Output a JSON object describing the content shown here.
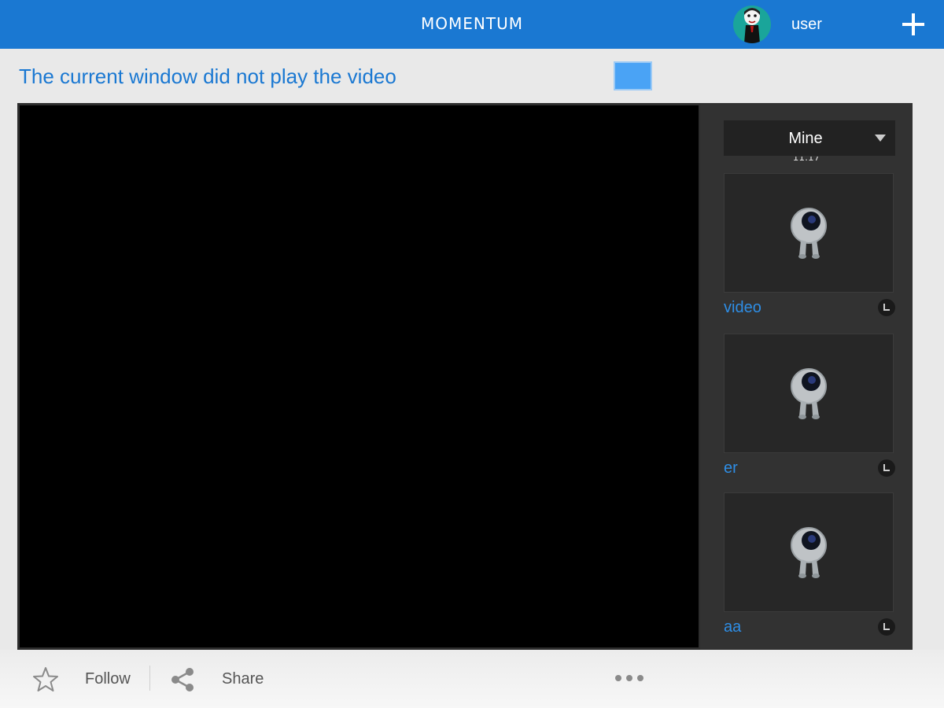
{
  "header": {
    "logo": "MOMENTUM",
    "username": "user",
    "add_icon": "plus-icon",
    "avatar_icon": "avatar"
  },
  "page": {
    "title": "The current window did not play the video"
  },
  "sidebar": {
    "dropdown_value": "Mine",
    "clipped_text": "11:17",
    "items": [
      {
        "label": "video",
        "icon": "clock-icon"
      },
      {
        "label": "er",
        "icon": "clock-icon"
      },
      {
        "label": "aa",
        "icon": "clock-icon"
      }
    ]
  },
  "footer": {
    "follow_label": "Follow",
    "share_label": "Share",
    "star_icon": "star-icon",
    "share_icon": "share-icon",
    "more_icon": "more-icon"
  },
  "colors": {
    "header_bg": "#1a78d2",
    "title": "#1a78d2",
    "item_label": "#2e8ee6",
    "panel_bg": "#2d2d2d"
  }
}
